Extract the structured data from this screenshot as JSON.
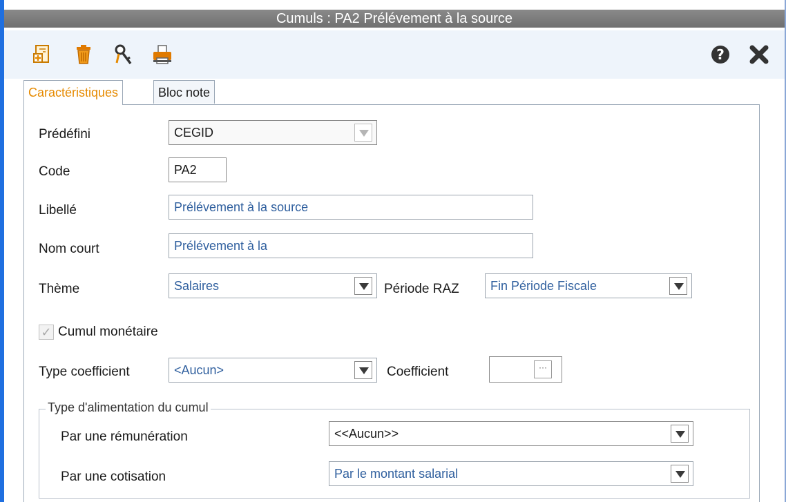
{
  "window": {
    "title": "Cumuls  : PA2 Prélévement à la source"
  },
  "toolbar": {
    "icons": [
      "new-document-icon",
      "trash-icon",
      "key-icon",
      "print-icon"
    ],
    "right_icons": [
      "help-icon",
      "close-icon"
    ]
  },
  "tabs": [
    {
      "label": "Caractéristiques",
      "active": true
    },
    {
      "label": "Bloc note",
      "active": false
    }
  ],
  "form": {
    "predefini": {
      "label": "Prédéfini",
      "value": "CEGID"
    },
    "code": {
      "label": "Code",
      "value": "PA2"
    },
    "libelle": {
      "label": "Libellé",
      "value": "Prélévement à la source"
    },
    "nom_court": {
      "label": "Nom court",
      "value": "Prélévement à la"
    },
    "theme": {
      "label": "Thème",
      "value": "Salaires"
    },
    "periode_raz": {
      "label": "Période RAZ",
      "value": "Fin Période Fiscale"
    },
    "cumul_monetaire": {
      "label": "Cumul monétaire",
      "checked": true
    },
    "type_coefficient": {
      "label": "Type coefficient",
      "value": "<Aucun>"
    },
    "coefficient": {
      "label": "Coefficient",
      "value": "",
      "button": "···"
    }
  },
  "alimentation": {
    "title": "Type d'alimentation du cumul",
    "remuneration": {
      "label": "Par une rémunération",
      "value": "<<Aucun>>"
    },
    "cotisation": {
      "label": "Par une cotisation",
      "value": "Par le montant salarial"
    }
  },
  "colors": {
    "titlebar": "#7c7c7c",
    "accent_tab": "#e68a00",
    "field_text": "#2f5f9e",
    "window_border": "#1f6fe0"
  }
}
